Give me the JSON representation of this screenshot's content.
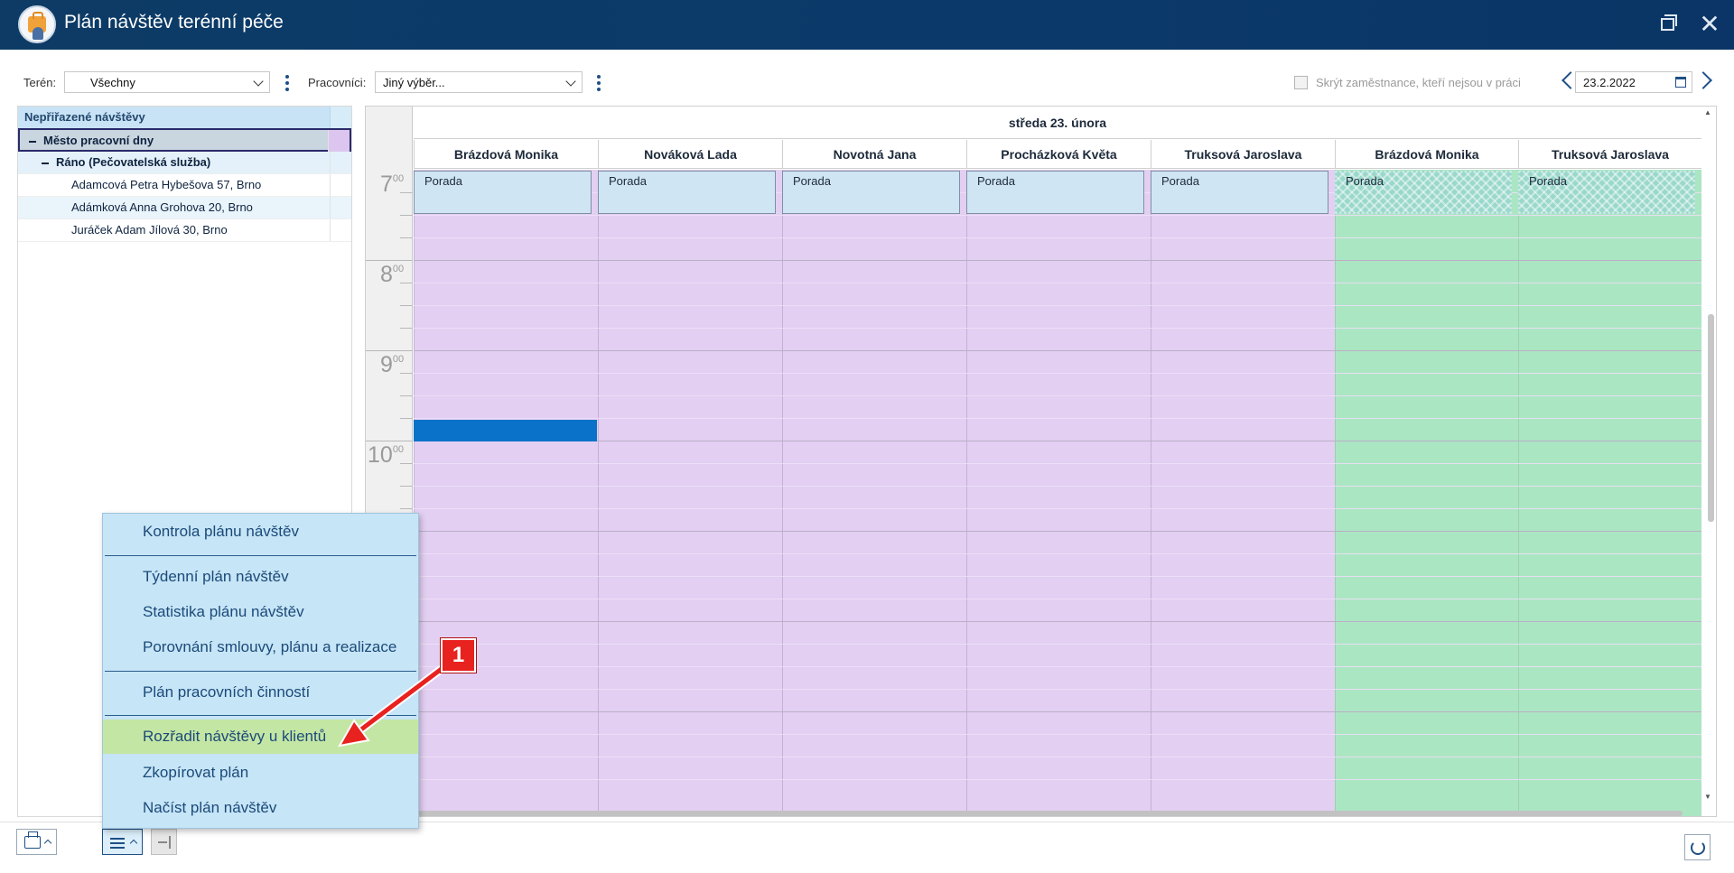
{
  "window": {
    "title": "Plán návštěv terénní péče"
  },
  "toolbar": {
    "teren_label": "Terén:",
    "teren_value": "Všechny",
    "pracovnici_label": "Pracovníci:",
    "pracovnici_value": "Jiný výběr...",
    "hide_label": "Skrýt zaměstnance, kteří nejsou v práci",
    "date_value": "23.2.2022"
  },
  "tree": {
    "header": "Nepřiřazené návštěvy",
    "group": "Město pracovní dny",
    "subgroup": "Ráno (Pečovatelská služba)",
    "items": [
      "Adamcová Petra Hybešova 57, Brno",
      "Adámková Anna Grohova 20, Brno",
      "Juráček Adam Jílová 30, Brno"
    ]
  },
  "calendar": {
    "day_title": "středa 23. února",
    "hours": [
      {
        "h": "7",
        "m": "00"
      },
      {
        "h": "8",
        "m": "00"
      },
      {
        "h": "9",
        "m": "00"
      },
      {
        "h": "10",
        "m": "00"
      }
    ],
    "employees": [
      "Brázdová Monika",
      "Nováková Lada",
      "Novotná Jana",
      "Procházková Květa",
      "Truksová Jaroslava",
      "Brázdová Monika",
      "Truksová Jaroslava"
    ],
    "event_label": "Porada",
    "colors": {
      "work": "#e3cff2",
      "off": "#abe6c3",
      "event": "#cfe5f3",
      "selection": "#0a72c8"
    }
  },
  "menu": {
    "items": [
      "Kontrola plánu návštěv",
      "Týdenní plán návštěv",
      "Statistika plánu návštěv",
      "Porovnání smlouvy, plánu a realizace",
      "Plán pracovních činností",
      "Rozřadit návštěvy u klientů",
      "Zkopírovat plán",
      "Načíst plán návštěv"
    ]
  },
  "annotation": {
    "badge": "1",
    "color": "#e8221f"
  }
}
